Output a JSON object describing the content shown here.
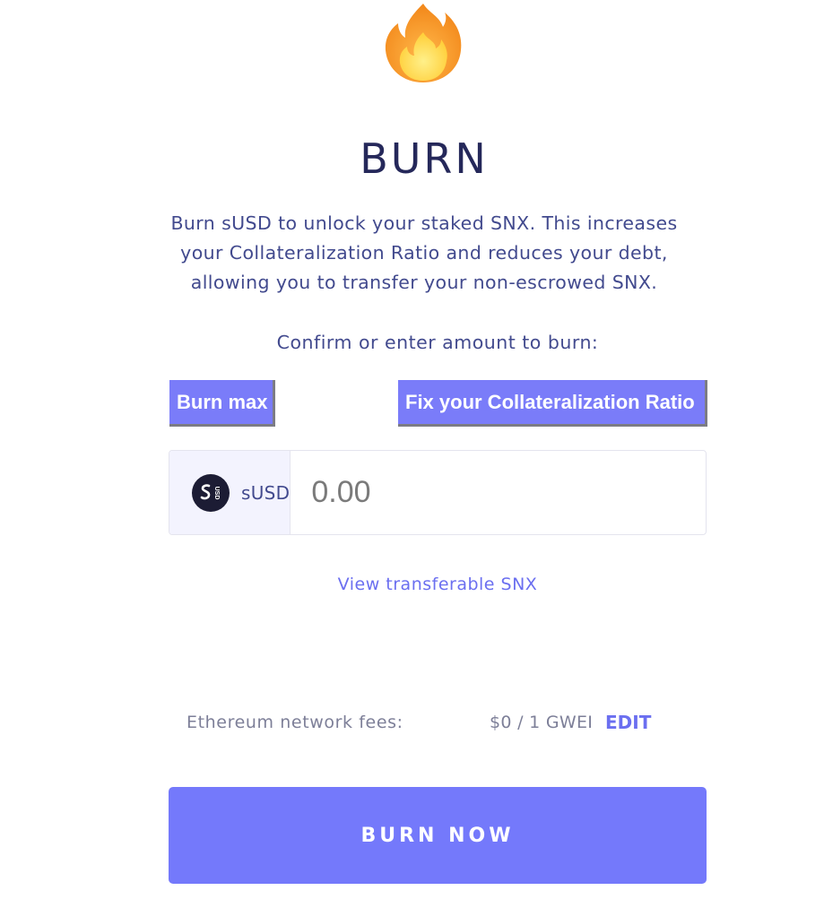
{
  "header": {
    "icon": "fire-icon",
    "title": "BURN"
  },
  "description": {
    "lines": [
      "Burn sUSD to unlock your staked SNX. This increases",
      "your Collateralization Ratio and reduces your debt,",
      "allowing you to transfer your non-escrowed SNX."
    ]
  },
  "prompt": "Confirm or enter amount to burn:",
  "actions": {
    "burn_max_label": "Burn max",
    "fix_ratio_label": "Fix your Collateralization Ratio"
  },
  "amount": {
    "currency_icon": "susd-token-icon",
    "currency": "sUSD",
    "value": "",
    "placeholder": "0.00"
  },
  "link": {
    "label": "View transferable SNX"
  },
  "fees": {
    "label": "Ethereum network fees:",
    "value": "$0 / 1 GWEI",
    "edit_label": "EDIT"
  },
  "submit": {
    "label": "BURN NOW"
  },
  "colors": {
    "accent": "#7479fb",
    "title": "#25285a",
    "text": "#424a8e",
    "muted": "#7d7f98"
  }
}
